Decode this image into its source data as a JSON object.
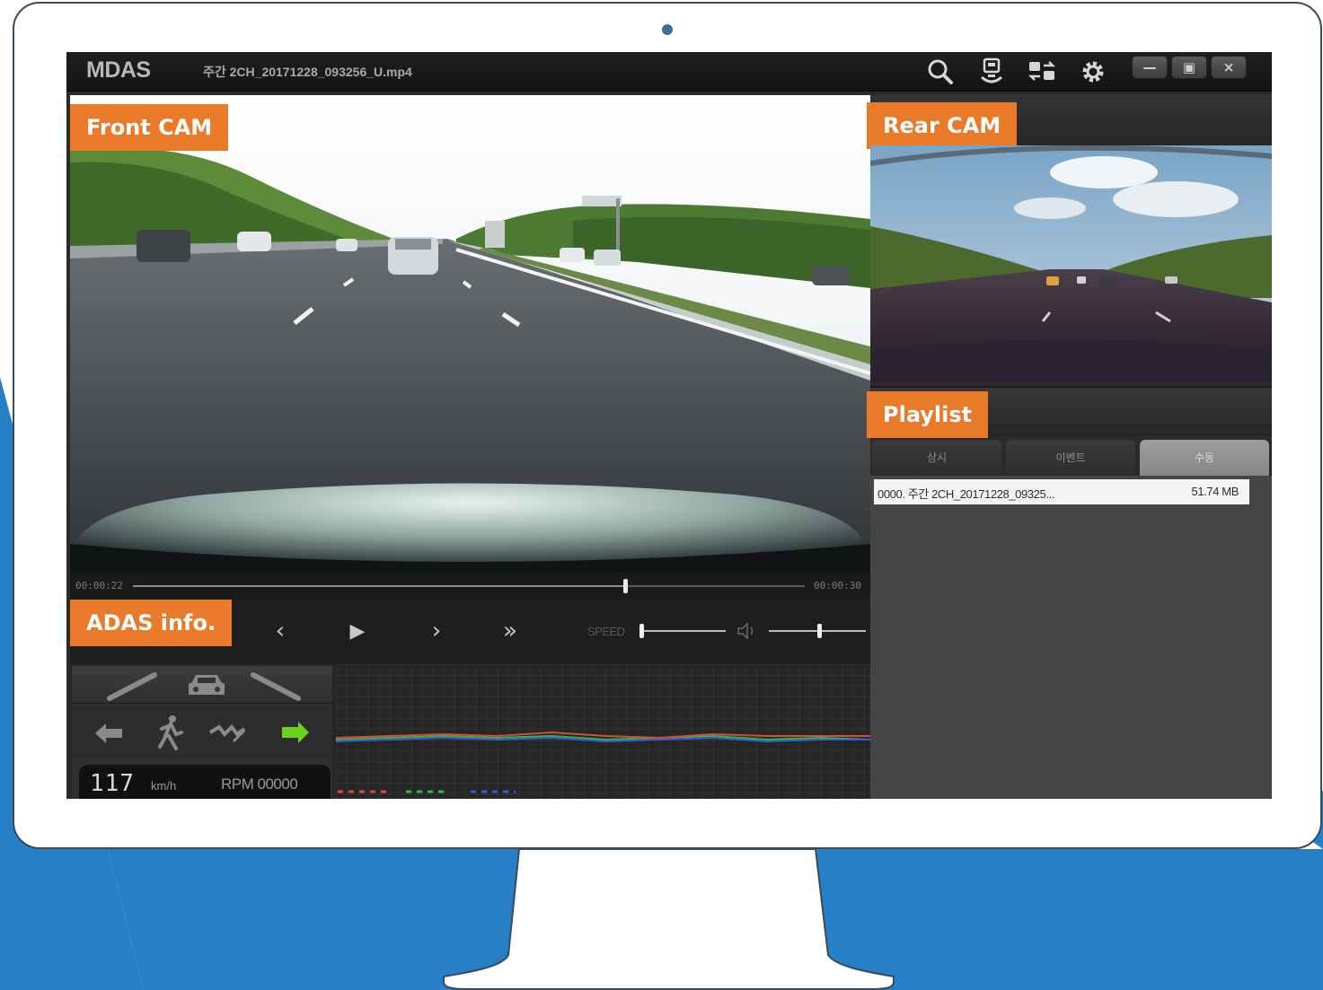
{
  "colors": {
    "backdrop_blue": "#2580c8",
    "label_orange": "#e87a2a",
    "monitor_border": "#3a4a57",
    "indicator_green": "#6fcf1f"
  },
  "app": {
    "name": "MDAS",
    "file_title": "주간 2CH_20171228_093256_U.mp4",
    "toolbar_icons": [
      "search-icon",
      "user-download-icon",
      "swap-cameras-icon",
      "settings-gear-icon"
    ],
    "window_controls": {
      "minimize": "—",
      "maximize": "▣",
      "close": "×"
    }
  },
  "labels": {
    "front_cam": "Front CAM",
    "rear_cam": "Rear CAM",
    "playlist": "Playlist",
    "adas_info": "ADAS info."
  },
  "playback": {
    "current_time": "00:00:22",
    "total_time": "00:00:30",
    "progress": 0.733,
    "speed_label": "SPEED",
    "speed_level": 0.0,
    "volume_level": 0.5,
    "buttons": {
      "prev": "‹",
      "play": "▶",
      "next": "›",
      "fast_forward": "»"
    }
  },
  "adas": {
    "speed": "117",
    "speed_unit": "km/h",
    "rpm": "RPM 00000",
    "icons_row1": [
      "lane-left-icon",
      "vehicle-icon",
      "lane-right-icon"
    ],
    "icons_row2": [
      "turn-left-arrow-icon",
      "pedestrian-icon",
      "lane-departure-icon",
      "turn-right-arrow-icon"
    ]
  },
  "playlist": {
    "tabs": [
      {
        "label": "상시",
        "active": false
      },
      {
        "label": "이벤트",
        "active": false
      },
      {
        "label": "수동",
        "active": true
      }
    ],
    "items": [
      {
        "name": "0000. 주간 2CH_20171228_09325...",
        "size": "51.74 MB"
      }
    ]
  }
}
